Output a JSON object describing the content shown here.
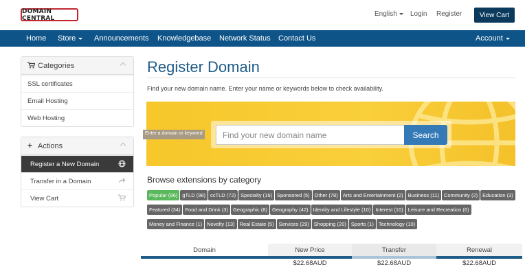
{
  "brand": {
    "logo_text": "DOMAIN CENTRAL"
  },
  "topbar": {
    "language": "English",
    "login": "Login",
    "register": "Register",
    "view_cart": "View Cart"
  },
  "nav": {
    "items": [
      "Home",
      "Store",
      "Announcements",
      "Knowledgebase",
      "Network Status",
      "Contact Us"
    ],
    "account": "Account"
  },
  "sidebar": {
    "categories": {
      "title": "Categories",
      "items": [
        "SSL certificates",
        "Email Hosting",
        "Web Hosting"
      ]
    },
    "actions": {
      "title": "Actions",
      "items": [
        "Register a New Domain",
        "Transfer in a Domain",
        "View Cart"
      ]
    }
  },
  "main": {
    "title": "Register Domain",
    "intro": "Find your new domain name. Enter your name or keywords below to check availability.",
    "search_placeholder": "Find your new domain name",
    "search_button": "Search",
    "tooltip": "Enter a domain or keyword",
    "browse_title": "Browse extensions by category",
    "tags": [
      "Popular (96)",
      "gTLD (98)",
      "ccTLD (72)",
      "Specialty (16)",
      "Sponsored (5)",
      "Other (78)",
      "Arts and Entertainment (2)",
      "Business (11)",
      "Community (2)",
      "Education (3)",
      "Featured (34)",
      "Food and Drink (3)",
      "Geographic (8)",
      "Geography (42)",
      "Identity and Lifestyle (10)",
      "Interest (10)",
      "Leisure and Recreation (6)",
      "Money and Finance (1)",
      "Novelty (13)",
      "Real Estate (5)",
      "Services (29)",
      "Shopping (20)",
      "Sports (1)",
      "Technology (10)"
    ],
    "active_tag": 0
  },
  "pricing": {
    "headers": [
      "Domain",
      "New Price",
      "Transfer",
      "Renewal"
    ],
    "row": [
      "",
      "$22.68AUD",
      "$22.68AUD",
      "$22.68AUD"
    ]
  },
  "colors": {
    "navbar": "#0f5489",
    "title": "#1f5c88",
    "search_button": "#337ab7",
    "banner": "#f7c72b",
    "tag": "#666666",
    "tag_active": "#5cb85c",
    "view_cart_button": "#0b3a5c"
  }
}
